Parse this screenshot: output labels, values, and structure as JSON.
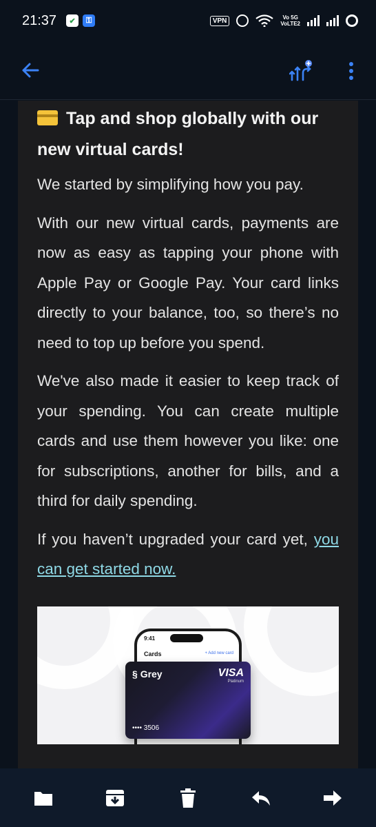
{
  "status_bar": {
    "time": "21:37",
    "vpn": "VPN",
    "network_top": "Vo 5G",
    "network_bottom": "VoLTE2",
    "icons": [
      "shield-icon",
      "key-icon",
      "alarm-icon",
      "wifi-icon",
      "signal-icon",
      "battery-icon"
    ]
  },
  "app_bar": {
    "icons": [
      "back-arrow-icon",
      "summarize-icon",
      "more-vert-icon"
    ],
    "accent": "#3b82f6"
  },
  "email": {
    "headline": "Tap and shop globally with our new virtual cards!",
    "paragraphs": [
      "We started by simplifying how you pay.",
      "With our new virtual cards, payments are now as easy as tapping your phone with Apple Pay or Google Pay. Your card links directly to your balance, too, so there’s no need to top up before you spend.",
      "We've also made it easier to keep track of your spending. You can create multiple cards and use them however you like: one for subscriptions, another for bills, and a third for daily spending."
    ],
    "last_paragraph_prefix": "If you haven’t upgraded your card yet, ",
    "link_text": "you can get started now.",
    "link_color": "#8fd9e6",
    "promo": {
      "phone_time": "9:41",
      "phone_title": "Cards",
      "phone_add": "+ Add new card",
      "card_brand": "Grey",
      "card_network": "VISA",
      "card_tier": "Platinum",
      "card_number": "•••• 3506"
    }
  },
  "bottom_bar": {
    "icons": [
      "folder-icon",
      "archive-icon",
      "trash-icon",
      "reply-icon",
      "forward-icon"
    ]
  }
}
